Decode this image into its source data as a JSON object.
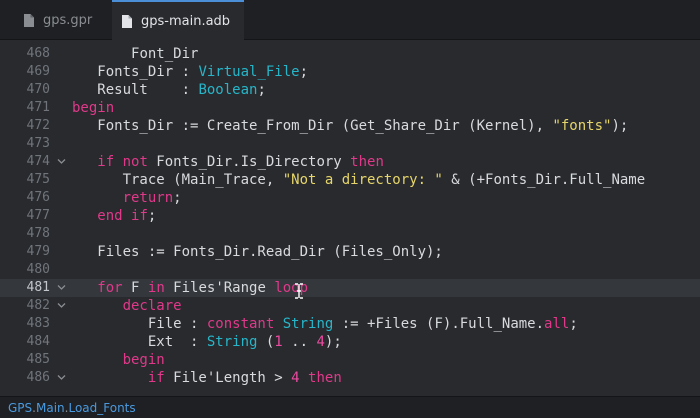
{
  "tabs": [
    {
      "label": "gps.gpr",
      "active": false
    },
    {
      "label": "gps-main.adb",
      "active": true
    }
  ],
  "colors": {
    "keyword": "#e0398a",
    "type": "#27b6c9",
    "string": "#e6d56a",
    "accent": "#4a8fd8"
  },
  "current_line": "481",
  "lines": [
    {
      "no": "468",
      "fold": false,
      "tokens": [
        [
          "       ",
          "id"
        ],
        [
          "Font_Dir",
          "id"
        ]
      ]
    },
    {
      "no": "469",
      "fold": false,
      "tokens": [
        [
          "   Fonts_Dir : ",
          "id"
        ],
        [
          "Virtual_File",
          "ty"
        ],
        [
          ";",
          "id"
        ]
      ]
    },
    {
      "no": "470",
      "fold": false,
      "tokens": [
        [
          "   Result    : ",
          "id"
        ],
        [
          "Boolean",
          "ty"
        ],
        [
          ";",
          "id"
        ]
      ]
    },
    {
      "no": "471",
      "fold": false,
      "tokens": [
        [
          "begin",
          "kw"
        ]
      ]
    },
    {
      "no": "472",
      "fold": false,
      "tokens": [
        [
          "   Fonts_Dir := Create_From_Dir (Get_Share_Dir (Kernel), ",
          "id"
        ],
        [
          "\"fonts\"",
          "st"
        ],
        [
          ");",
          "id"
        ]
      ]
    },
    {
      "no": "473",
      "fold": false,
      "tokens": []
    },
    {
      "no": "474",
      "fold": true,
      "tokens": [
        [
          "   ",
          "id"
        ],
        [
          "if not",
          "kw"
        ],
        [
          " Fonts_Dir.Is_Directory ",
          "id"
        ],
        [
          "then",
          "kw"
        ]
      ]
    },
    {
      "no": "475",
      "fold": false,
      "tokens": [
        [
          "      Trace (Main_Trace, ",
          "id"
        ],
        [
          "\"Not a directory: \"",
          "st"
        ],
        [
          " & (+Fonts_Dir.Full_Name",
          "id"
        ]
      ]
    },
    {
      "no": "476",
      "fold": false,
      "tokens": [
        [
          "      ",
          "id"
        ],
        [
          "return",
          "kw"
        ],
        [
          ";",
          "id"
        ]
      ]
    },
    {
      "no": "477",
      "fold": false,
      "tokens": [
        [
          "   ",
          "id"
        ],
        [
          "end if",
          "kw"
        ],
        [
          ";",
          "id"
        ]
      ]
    },
    {
      "no": "478",
      "fold": false,
      "tokens": []
    },
    {
      "no": "479",
      "fold": false,
      "tokens": [
        [
          "   Files := Fonts_Dir.Read_Dir (Files_Only);",
          "id"
        ]
      ]
    },
    {
      "no": "480",
      "fold": false,
      "tokens": []
    },
    {
      "no": "481",
      "fold": true,
      "tokens": [
        [
          "   ",
          "id"
        ],
        [
          "for",
          "kw"
        ],
        [
          " F ",
          "id"
        ],
        [
          "in",
          "kw"
        ],
        [
          " Files'Range ",
          "id"
        ],
        [
          "loop",
          "kw"
        ]
      ]
    },
    {
      "no": "482",
      "fold": true,
      "tokens": [
        [
          "      ",
          "id"
        ],
        [
          "declare",
          "kw"
        ]
      ]
    },
    {
      "no": "483",
      "fold": false,
      "tokens": [
        [
          "         File : ",
          "id"
        ],
        [
          "constant",
          "kw"
        ],
        [
          " ",
          "id"
        ],
        [
          "String",
          "ty"
        ],
        [
          " := +Files (F).Full_Name.",
          "id"
        ],
        [
          "all",
          "kw"
        ],
        [
          ";",
          "id"
        ]
      ]
    },
    {
      "no": "484",
      "fold": false,
      "tokens": [
        [
          "         Ext  : ",
          "id"
        ],
        [
          "String",
          "ty"
        ],
        [
          " (",
          "id"
        ],
        [
          "1",
          "nm"
        ],
        [
          " .. ",
          "id"
        ],
        [
          "4",
          "nm"
        ],
        [
          ");",
          "id"
        ]
      ]
    },
    {
      "no": "485",
      "fold": false,
      "tokens": [
        [
          "      ",
          "id"
        ],
        [
          "begin",
          "kw"
        ]
      ]
    },
    {
      "no": "486",
      "fold": true,
      "tokens": [
        [
          "         ",
          "id"
        ],
        [
          "if",
          "kw"
        ],
        [
          " File'Length > ",
          "id"
        ],
        [
          "4",
          "nm"
        ],
        [
          " ",
          "id"
        ],
        [
          "then",
          "kw"
        ]
      ]
    }
  ],
  "status": {
    "breadcrumb": [
      "GPS",
      "Main",
      "Load_Fonts"
    ],
    "separator": "."
  }
}
